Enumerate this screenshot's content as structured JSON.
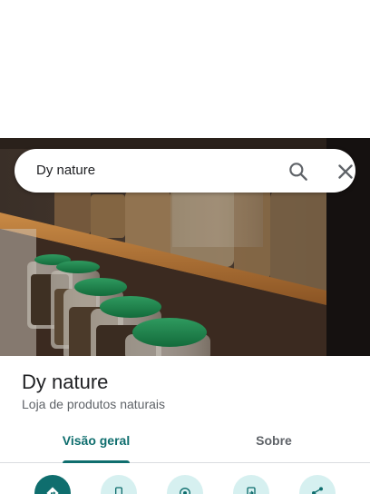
{
  "search": {
    "query": "Dy nature",
    "search_icon": "search-icon",
    "close_icon": "close-icon"
  },
  "place": {
    "name": "Dy nature",
    "category": "Loja de produtos naturais"
  },
  "tabs": [
    {
      "label": "Visão geral",
      "selected": true
    },
    {
      "label": "Sobre",
      "selected": false
    }
  ],
  "actions": [
    {
      "icon": "directions-icon"
    },
    {
      "icon": "phone-icon"
    },
    {
      "icon": "nearby-icon"
    },
    {
      "icon": "send-to-phone-icon"
    },
    {
      "icon": "share-icon"
    }
  ],
  "colors": {
    "accent": "#0f6e6e",
    "accent_light": "#d6f0f0",
    "text_primary": "#202124",
    "text_secondary": "#5f6368"
  }
}
